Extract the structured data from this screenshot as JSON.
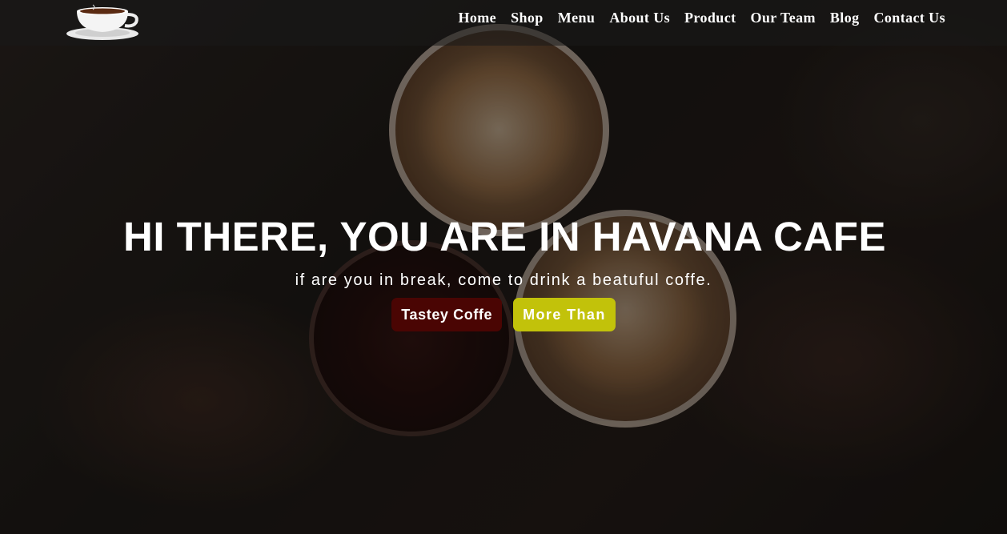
{
  "nav": {
    "logo_icon": "coffee-cup-logo-icon",
    "links": [
      "Home",
      "Shop",
      "Menu",
      "About Us",
      "Product",
      "Our Team",
      "Blog",
      "Contact Us"
    ]
  },
  "hero": {
    "title": "HI THERE, YOU ARE IN HAVANA CAFE",
    "subtitle": "if are you in break, come to drink a beatuful coffe.",
    "primary_button": "Tastey Coffe",
    "secondary_button": "More Than"
  },
  "colors": {
    "primary_button_bg": "#4a0503",
    "secondary_button_bg": "#c2c20a",
    "navbar_bg": "#191919",
    "text": "#ffffff"
  }
}
